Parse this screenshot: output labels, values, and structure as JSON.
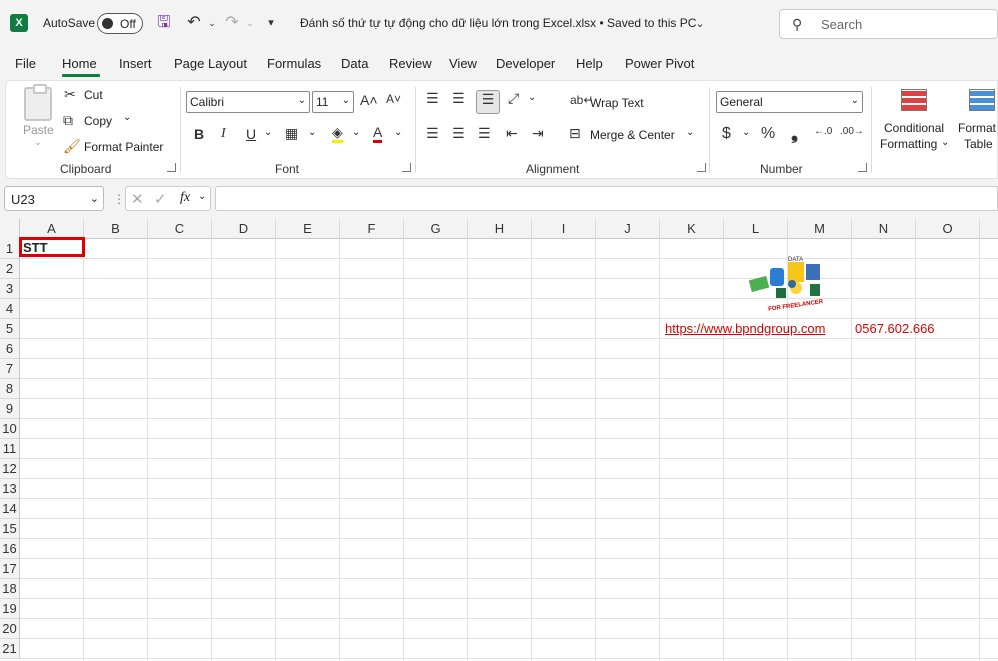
{
  "titlebar": {
    "autosave_label": "AutoSave",
    "toggle_state": "Off",
    "document_title": "Đánh số thứ tự tự động cho dữ liệu lớn trong Excel.xlsx  •  Saved to this PC",
    "search_placeholder": "Search"
  },
  "tabs": [
    "File",
    "Home",
    "Insert",
    "Page Layout",
    "Formulas",
    "Data",
    "Review",
    "View",
    "Developer",
    "Help",
    "Power Pivot"
  ],
  "active_tab": "Home",
  "ribbon": {
    "clipboard": {
      "label": "Clipboard",
      "paste": "Paste",
      "cut": "Cut",
      "copy": "Copy",
      "format_painter": "Format Painter"
    },
    "font": {
      "label": "Font",
      "font_name": "Calibri",
      "font_size": "11"
    },
    "alignment": {
      "label": "Alignment",
      "wrap_text": "Wrap Text",
      "merge_center": "Merge & Center"
    },
    "number": {
      "label": "Number",
      "format": "General",
      "currency": "$",
      "percent": "%",
      "comma": "❟"
    },
    "styles": {
      "conditional_1": "Conditional",
      "conditional_2": "Formatting",
      "format_1": "Format",
      "format_2": "Table"
    }
  },
  "formula_bar": {
    "name_box": "U23",
    "fx": "fx",
    "value": ""
  },
  "columns": [
    "A",
    "B",
    "C",
    "D",
    "E",
    "F",
    "G",
    "H",
    "I",
    "J",
    "K",
    "L",
    "M",
    "N",
    "O"
  ],
  "rows": [
    "1",
    "2",
    "3",
    "4",
    "5",
    "6",
    "7",
    "8",
    "9",
    "10",
    "11",
    "12",
    "13",
    "14",
    "15",
    "16",
    "17",
    "18",
    "19",
    "20",
    "21"
  ],
  "cells": {
    "A1": "STT",
    "K5": "https://www.bpndgroup.com",
    "N5": "0567.602.666"
  },
  "logo": {
    "top_text": "DATA",
    "bottom_text": "FOR FREELANCER"
  },
  "colors": {
    "accent": "#107c41",
    "highlight": "#e00000"
  }
}
